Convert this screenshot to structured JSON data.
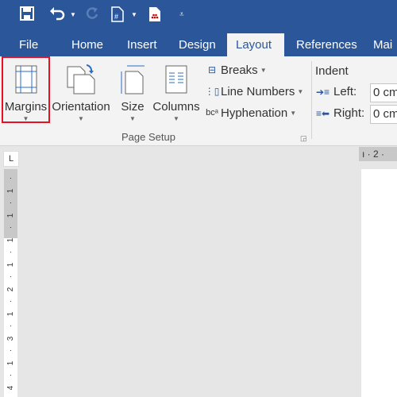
{
  "quick_access": {
    "icons": [
      "save-icon",
      "undo-icon",
      "undo-dropdown-icon",
      "redo-icon",
      "insert-field-icon",
      "field-dropdown-icon",
      "document-icon",
      "customize-qat-icon"
    ]
  },
  "tabs": [
    {
      "label": "File",
      "active": false
    },
    {
      "label": "Home",
      "active": false
    },
    {
      "label": "Insert",
      "active": false
    },
    {
      "label": "Design",
      "active": false
    },
    {
      "label": "Layout",
      "active": true
    },
    {
      "label": "References",
      "active": false
    },
    {
      "label": "Mai",
      "active": false
    }
  ],
  "ribbon": {
    "page_setup": {
      "label": "Page Setup",
      "big_buttons": [
        {
          "label": "Margins",
          "highlighted": true
        },
        {
          "label": "Orientation"
        },
        {
          "label": "Size"
        },
        {
          "label": "Columns"
        }
      ],
      "small_buttons": [
        {
          "label": "Breaks"
        },
        {
          "label": "Line Numbers"
        },
        {
          "label": "Hyphenation"
        }
      ]
    },
    "indent": {
      "title": "Indent",
      "left_label": "Left:",
      "left_value": "0 cm",
      "right_label": "Right:",
      "right_value": "0 cm"
    }
  },
  "ruler": {
    "corner_symbol": "L",
    "vertical_ticks": [
      "·",
      "1",
      "·",
      "1",
      "·",
      "1",
      "·",
      "1",
      "·",
      "2",
      "·",
      "1",
      "·",
      "3",
      "·",
      "1",
      "·",
      "4"
    ],
    "horizontal_text": "ı · 2 ·"
  },
  "colors": {
    "accent": "#2b579a",
    "highlight": "#e81123"
  }
}
